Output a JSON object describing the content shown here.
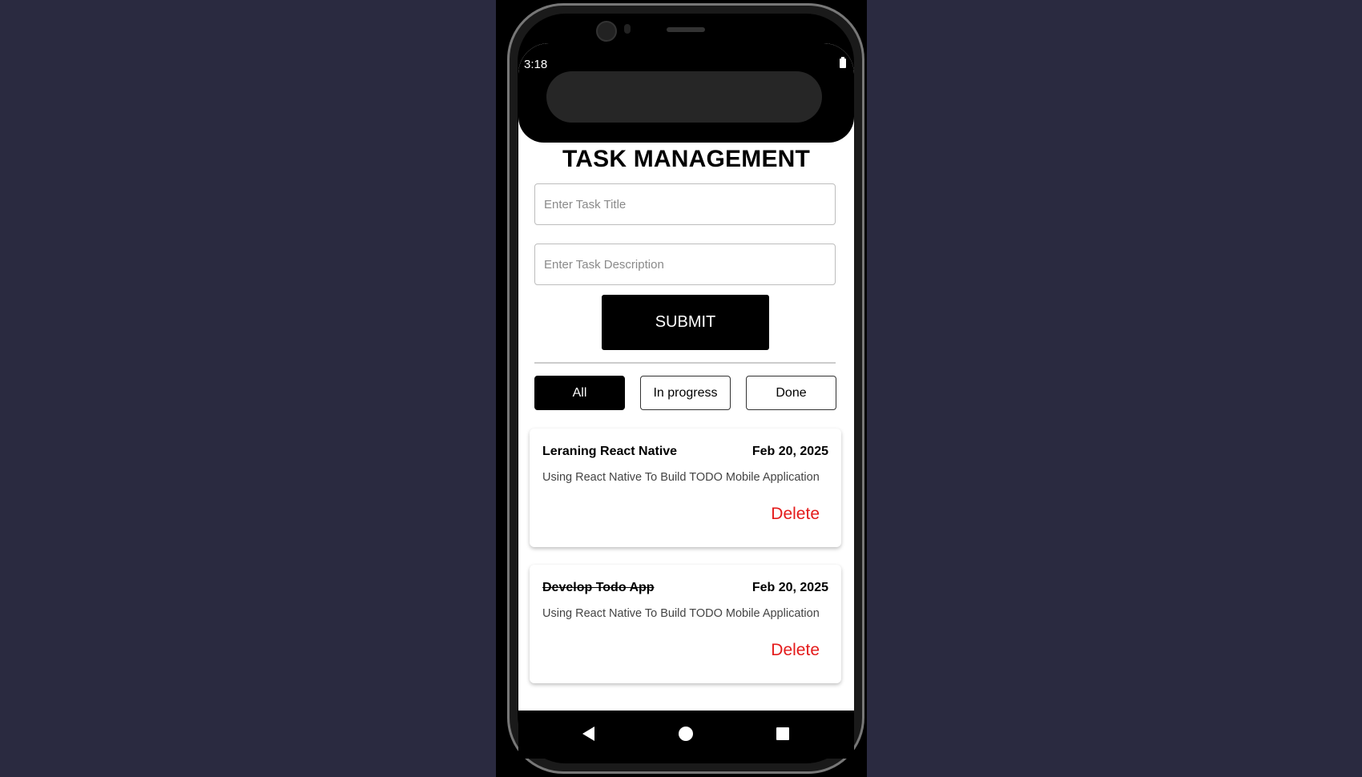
{
  "status_bar": {
    "time": "3:18"
  },
  "app": {
    "title": "TASK MANAGEMENT"
  },
  "form": {
    "title_placeholder": "Enter Task Title",
    "title_value": "",
    "description_placeholder": "Enter Task Description",
    "description_value": "",
    "submit_label": "SUBMIT"
  },
  "filters": [
    {
      "label": "All",
      "active": true
    },
    {
      "label": "In progress",
      "active": false
    },
    {
      "label": "Done",
      "active": false
    }
  ],
  "tasks": [
    {
      "title": "Leraning React Native",
      "date": "Feb 20, 2025",
      "description": "Using React Native To Build TODO Mobile Application",
      "done": false,
      "delete_label": "Delete"
    },
    {
      "title": "Develop Todo App",
      "date": "Feb 20, 2025",
      "description": "Using React Native To Build TODO Mobile Application",
      "done": true,
      "delete_label": "Delete"
    }
  ],
  "colors": {
    "accent": "#000000",
    "delete": "#e41b1b",
    "backdrop": "#2a2a40"
  },
  "icons": {
    "battery": "battery-icon",
    "back": "back-icon",
    "home": "home-icon",
    "recents": "recents-icon"
  }
}
